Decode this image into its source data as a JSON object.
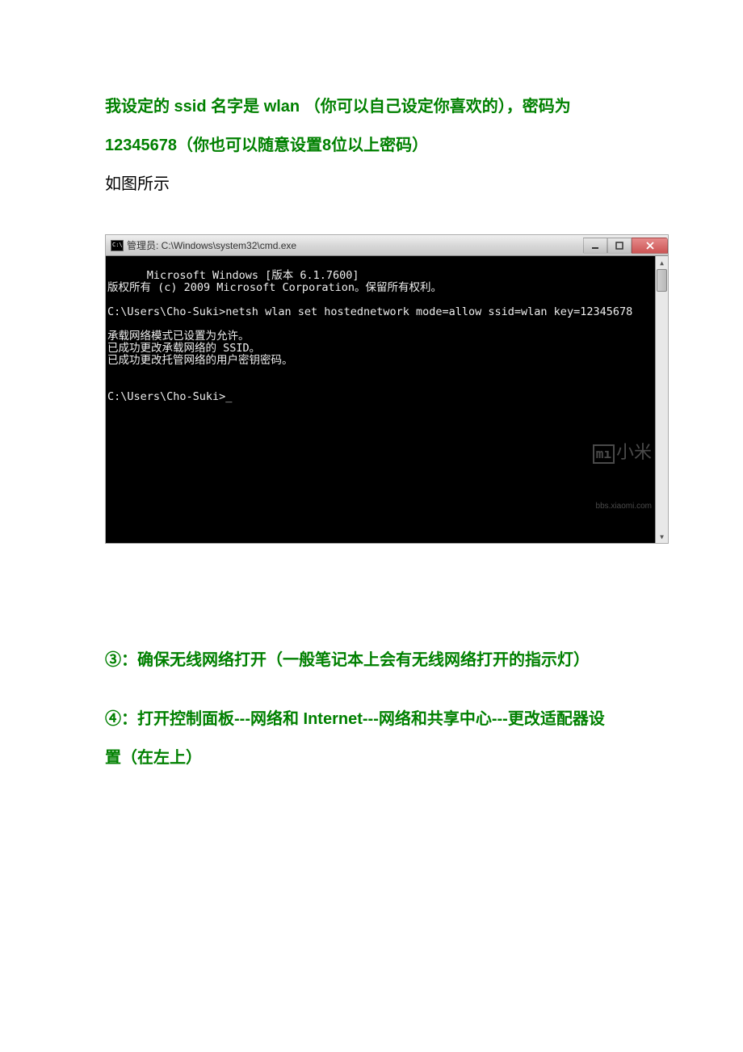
{
  "intro": {
    "line1": "我设定的 ssid 名字是 wlan （你可以自己设定你喜欢的），密码为",
    "line2": "12345678（你也可以随意设置8位以上密码）",
    "subline": "如图所示"
  },
  "cmd_window": {
    "title": "管理员: C:\\Windows\\system32\\cmd.exe",
    "content": "Microsoft Windows [版本 6.1.7600]\n版权所有 (c) 2009 Microsoft Corporation。保留所有权利。\n\nC:\\Users\\Cho-Suki>netsh wlan set hostednetwork mode=allow ssid=wlan key=12345678\n\n承载网络模式已设置为允许。\n已成功更改承载网络的 SSID。\n已成功更改托管网络的用户密钥密码。\n\n\nC:\\Users\\Cho-Suki>_"
  },
  "watermark": {
    "brand_icon": "mı",
    "brand_text": "小米",
    "url": "bbs.xiaomi.com"
  },
  "steps": {
    "step3": "③：确保无线网络打开（一般笔记本上会有无线网络打开的指示灯）",
    "step4_line1": "④：打开控制面板---网络和 Internet---网络和共享中心---更改适配器设",
    "step4_line2": "置（在左上）"
  }
}
